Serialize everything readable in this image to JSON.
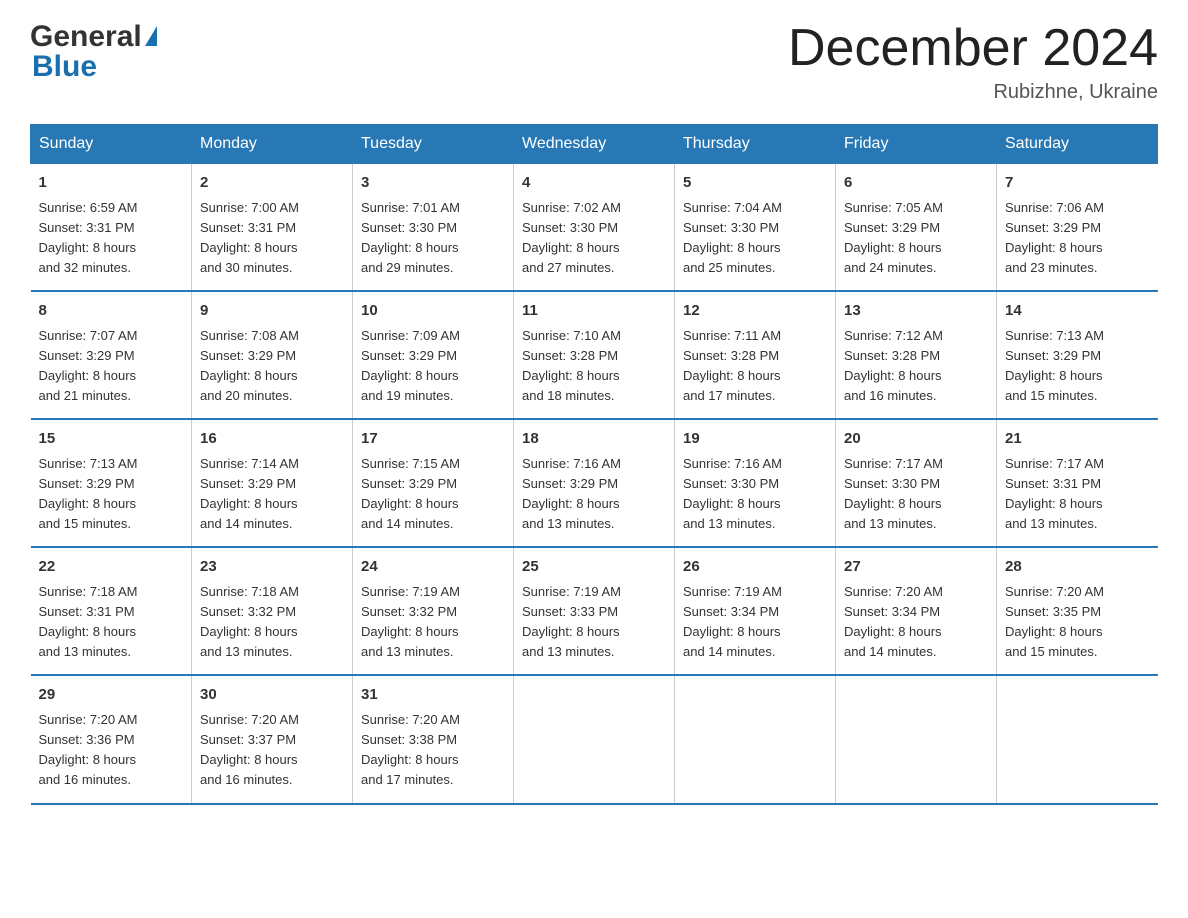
{
  "header": {
    "logo_general": "General",
    "logo_blue": "Blue",
    "month_title": "December 2024",
    "location": "Rubizhne, Ukraine"
  },
  "days_of_week": [
    "Sunday",
    "Monday",
    "Tuesday",
    "Wednesday",
    "Thursday",
    "Friday",
    "Saturday"
  ],
  "weeks": [
    [
      {
        "day": "1",
        "lines": [
          "Sunrise: 6:59 AM",
          "Sunset: 3:31 PM",
          "Daylight: 8 hours",
          "and 32 minutes."
        ]
      },
      {
        "day": "2",
        "lines": [
          "Sunrise: 7:00 AM",
          "Sunset: 3:31 PM",
          "Daylight: 8 hours",
          "and 30 minutes."
        ]
      },
      {
        "day": "3",
        "lines": [
          "Sunrise: 7:01 AM",
          "Sunset: 3:30 PM",
          "Daylight: 8 hours",
          "and 29 minutes."
        ]
      },
      {
        "day": "4",
        "lines": [
          "Sunrise: 7:02 AM",
          "Sunset: 3:30 PM",
          "Daylight: 8 hours",
          "and 27 minutes."
        ]
      },
      {
        "day": "5",
        "lines": [
          "Sunrise: 7:04 AM",
          "Sunset: 3:30 PM",
          "Daylight: 8 hours",
          "and 25 minutes."
        ]
      },
      {
        "day": "6",
        "lines": [
          "Sunrise: 7:05 AM",
          "Sunset: 3:29 PM",
          "Daylight: 8 hours",
          "and 24 minutes."
        ]
      },
      {
        "day": "7",
        "lines": [
          "Sunrise: 7:06 AM",
          "Sunset: 3:29 PM",
          "Daylight: 8 hours",
          "and 23 minutes."
        ]
      }
    ],
    [
      {
        "day": "8",
        "lines": [
          "Sunrise: 7:07 AM",
          "Sunset: 3:29 PM",
          "Daylight: 8 hours",
          "and 21 minutes."
        ]
      },
      {
        "day": "9",
        "lines": [
          "Sunrise: 7:08 AM",
          "Sunset: 3:29 PM",
          "Daylight: 8 hours",
          "and 20 minutes."
        ]
      },
      {
        "day": "10",
        "lines": [
          "Sunrise: 7:09 AM",
          "Sunset: 3:29 PM",
          "Daylight: 8 hours",
          "and 19 minutes."
        ]
      },
      {
        "day": "11",
        "lines": [
          "Sunrise: 7:10 AM",
          "Sunset: 3:28 PM",
          "Daylight: 8 hours",
          "and 18 minutes."
        ]
      },
      {
        "day": "12",
        "lines": [
          "Sunrise: 7:11 AM",
          "Sunset: 3:28 PM",
          "Daylight: 8 hours",
          "and 17 minutes."
        ]
      },
      {
        "day": "13",
        "lines": [
          "Sunrise: 7:12 AM",
          "Sunset: 3:28 PM",
          "Daylight: 8 hours",
          "and 16 minutes."
        ]
      },
      {
        "day": "14",
        "lines": [
          "Sunrise: 7:13 AM",
          "Sunset: 3:29 PM",
          "Daylight: 8 hours",
          "and 15 minutes."
        ]
      }
    ],
    [
      {
        "day": "15",
        "lines": [
          "Sunrise: 7:13 AM",
          "Sunset: 3:29 PM",
          "Daylight: 8 hours",
          "and 15 minutes."
        ]
      },
      {
        "day": "16",
        "lines": [
          "Sunrise: 7:14 AM",
          "Sunset: 3:29 PM",
          "Daylight: 8 hours",
          "and 14 minutes."
        ]
      },
      {
        "day": "17",
        "lines": [
          "Sunrise: 7:15 AM",
          "Sunset: 3:29 PM",
          "Daylight: 8 hours",
          "and 14 minutes."
        ]
      },
      {
        "day": "18",
        "lines": [
          "Sunrise: 7:16 AM",
          "Sunset: 3:29 PM",
          "Daylight: 8 hours",
          "and 13 minutes."
        ]
      },
      {
        "day": "19",
        "lines": [
          "Sunrise: 7:16 AM",
          "Sunset: 3:30 PM",
          "Daylight: 8 hours",
          "and 13 minutes."
        ]
      },
      {
        "day": "20",
        "lines": [
          "Sunrise: 7:17 AM",
          "Sunset: 3:30 PM",
          "Daylight: 8 hours",
          "and 13 minutes."
        ]
      },
      {
        "day": "21",
        "lines": [
          "Sunrise: 7:17 AM",
          "Sunset: 3:31 PM",
          "Daylight: 8 hours",
          "and 13 minutes."
        ]
      }
    ],
    [
      {
        "day": "22",
        "lines": [
          "Sunrise: 7:18 AM",
          "Sunset: 3:31 PM",
          "Daylight: 8 hours",
          "and 13 minutes."
        ]
      },
      {
        "day": "23",
        "lines": [
          "Sunrise: 7:18 AM",
          "Sunset: 3:32 PM",
          "Daylight: 8 hours",
          "and 13 minutes."
        ]
      },
      {
        "day": "24",
        "lines": [
          "Sunrise: 7:19 AM",
          "Sunset: 3:32 PM",
          "Daylight: 8 hours",
          "and 13 minutes."
        ]
      },
      {
        "day": "25",
        "lines": [
          "Sunrise: 7:19 AM",
          "Sunset: 3:33 PM",
          "Daylight: 8 hours",
          "and 13 minutes."
        ]
      },
      {
        "day": "26",
        "lines": [
          "Sunrise: 7:19 AM",
          "Sunset: 3:34 PM",
          "Daylight: 8 hours",
          "and 14 minutes."
        ]
      },
      {
        "day": "27",
        "lines": [
          "Sunrise: 7:20 AM",
          "Sunset: 3:34 PM",
          "Daylight: 8 hours",
          "and 14 minutes."
        ]
      },
      {
        "day": "28",
        "lines": [
          "Sunrise: 7:20 AM",
          "Sunset: 3:35 PM",
          "Daylight: 8 hours",
          "and 15 minutes."
        ]
      }
    ],
    [
      {
        "day": "29",
        "lines": [
          "Sunrise: 7:20 AM",
          "Sunset: 3:36 PM",
          "Daylight: 8 hours",
          "and 16 minutes."
        ]
      },
      {
        "day": "30",
        "lines": [
          "Sunrise: 7:20 AM",
          "Sunset: 3:37 PM",
          "Daylight: 8 hours",
          "and 16 minutes."
        ]
      },
      {
        "day": "31",
        "lines": [
          "Sunrise: 7:20 AM",
          "Sunset: 3:38 PM",
          "Daylight: 8 hours",
          "and 17 minutes."
        ]
      },
      {
        "day": "",
        "lines": []
      },
      {
        "day": "",
        "lines": []
      },
      {
        "day": "",
        "lines": []
      },
      {
        "day": "",
        "lines": []
      }
    ]
  ]
}
